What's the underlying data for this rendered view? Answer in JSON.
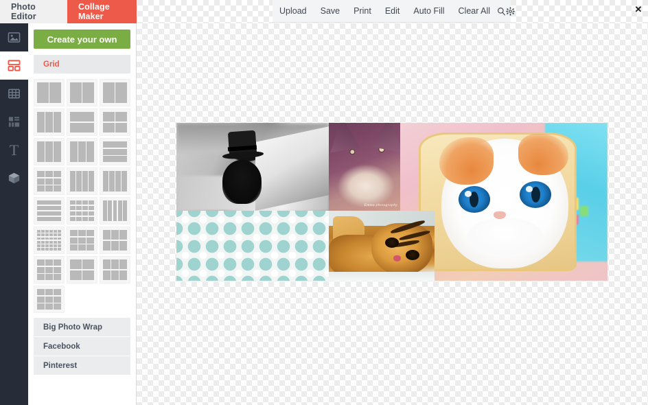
{
  "window": {
    "close_label": "✕"
  },
  "tabs": [
    {
      "label": "Photo Editor",
      "active": false
    },
    {
      "label": "Collage Maker",
      "active": true
    }
  ],
  "toolbar": {
    "items": [
      {
        "label": "Upload"
      },
      {
        "label": "Save"
      },
      {
        "label": "Print"
      },
      {
        "label": "Edit"
      },
      {
        "label": "Auto Fill"
      },
      {
        "label": "Clear All"
      }
    ],
    "icons": [
      {
        "name": "search-icon"
      },
      {
        "name": "settings-gear-icon"
      }
    ]
  },
  "rail": {
    "items": [
      {
        "name": "photo-icon",
        "active": false
      },
      {
        "name": "collage-grid-icon",
        "active": true
      },
      {
        "name": "table-grid-icon",
        "active": false
      },
      {
        "name": "layers-icon",
        "active": false
      },
      {
        "name": "text-icon",
        "glyph": "T",
        "active": false
      },
      {
        "name": "cube-icon",
        "active": false
      }
    ]
  },
  "panel": {
    "create_button": "Create your own",
    "section_label": "Grid",
    "templates": [
      {
        "id": 1,
        "cols": "1fr 1fr",
        "rows": "1fr",
        "cells": 2
      },
      {
        "id": 2,
        "cols": "1fr 1fr",
        "rows": "1fr",
        "cells": 2
      },
      {
        "id": 3,
        "cols": "1fr 1fr",
        "rows": "1fr",
        "cells": 2
      },
      {
        "id": 4,
        "cols": "1fr 1fr 1fr",
        "rows": "1fr",
        "cells": 3
      },
      {
        "id": 5,
        "cols": "1fr",
        "rows": "1fr 1fr",
        "cells": 2
      },
      {
        "id": 6,
        "cols": "1fr 1fr",
        "rows": "1fr 1fr",
        "cells": 4
      },
      {
        "id": 7,
        "cols": "1fr 1fr 1fr",
        "rows": "1fr",
        "cells": 3
      },
      {
        "id": 8,
        "cols": "1fr 1fr 1fr",
        "rows": "1fr",
        "cells": 3
      },
      {
        "id": 9,
        "cols": "1fr",
        "rows": "1fr 1fr 1fr",
        "cells": 3
      },
      {
        "id": 10,
        "cols": "1fr 1fr 1fr",
        "rows": "1fr 1fr 1fr",
        "cells": 9
      },
      {
        "id": 11,
        "cols": "1fr 1fr 1fr 1fr",
        "rows": "1fr",
        "cells": 4
      },
      {
        "id": 12,
        "cols": "1fr 1fr 1fr 1fr",
        "rows": "1fr",
        "cells": 4
      },
      {
        "id": 13,
        "cols": "1fr",
        "rows": "1fr 1fr 1fr 1fr",
        "cells": 4
      },
      {
        "id": 14,
        "cols": "1fr 1fr 1fr 1fr",
        "rows": "1fr 1fr 1fr 1fr",
        "cells": 16
      },
      {
        "id": 15,
        "cols": "1fr 1fr 1fr 1fr 1fr",
        "rows": "1fr",
        "cells": 5
      },
      {
        "id": 16,
        "cols": "1fr 1fr 1fr 1fr 1fr 1fr",
        "rows": "1fr 1fr 1fr 1fr 1fr 1fr",
        "cells": 36
      },
      {
        "id": 17,
        "cols": "1fr 1fr 1fr",
        "rows": "1fr 1fr 1fr",
        "cells": 9
      },
      {
        "id": 18,
        "cols": "1fr 1fr 1fr",
        "rows": "1fr 1fr",
        "cells": 6
      },
      {
        "id": 19,
        "cols": "1fr 1fr 1fr",
        "rows": "1fr 1fr 1fr",
        "cells": 9
      },
      {
        "id": 20,
        "cols": "1fr 1fr",
        "rows": "1fr 1fr",
        "cells": 4
      },
      {
        "id": 21,
        "cols": "1fr 1fr 1fr",
        "rows": "1fr 1fr",
        "cells": 6
      },
      {
        "id": 22,
        "cols": "1fr 1fr 1fr",
        "rows": "1fr 1fr 1fr",
        "cells": 9
      }
    ],
    "lists": [
      {
        "label": "Big Photo Wrap"
      },
      {
        "label": "Facebook"
      },
      {
        "label": "Pinterest"
      }
    ]
  },
  "canvas": {
    "collage_cells": [
      {
        "name": "photo-black-kitten-tophat",
        "description": "black kitten wearing top hat, black and white"
      },
      {
        "name": "photo-purple-cat-portrait",
        "description": "purple toned close-up cat face",
        "watermark": "Emma photography"
      },
      {
        "name": "photo-cat-in-bread",
        "description": "white and ginger cat face framed by a bread slice, blue eyes"
      },
      {
        "name": "pattern-teal-geometric",
        "description": "teal geometric flower lattice pattern"
      },
      {
        "name": "photo-tabby-cat-lying",
        "description": "orange tabby cat lying down, posterized"
      }
    ]
  },
  "colors": {
    "accent_red": "#ee5a4a",
    "accent_green": "#7aad43",
    "rail_dark": "#262d38",
    "panel_gray": "#e8e9ea",
    "text_dark": "#4a525e"
  }
}
